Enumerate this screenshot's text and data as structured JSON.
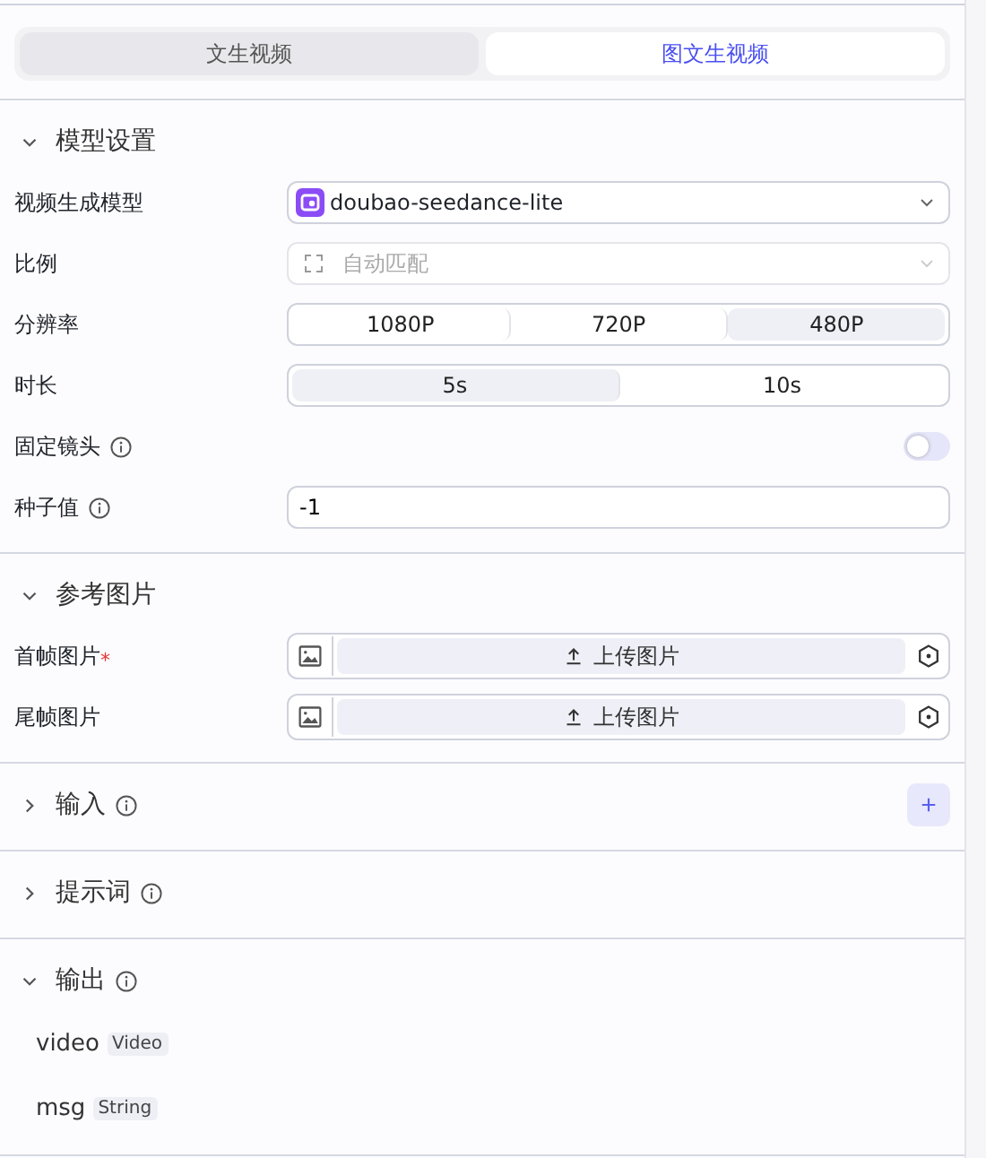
{
  "mode_tabs": [
    {
      "label": "文生视频",
      "selected": false
    },
    {
      "label": "图文生视频",
      "selected": true
    }
  ],
  "sections": [
    {
      "title": "模型设置",
      "expanded": true,
      "info": false,
      "fields": [
        {
          "kind": "model_select",
          "label": "视频生成模型",
          "value": "doubao-seedance-lite",
          "disabled": false
        },
        {
          "kind": "ratio_select",
          "label": "比例",
          "value": "自动匹配",
          "disabled": true
        },
        {
          "kind": "segmented",
          "label": "分辨率",
          "options": [
            {
              "label": "1080P",
              "selected": false
            },
            {
              "label": "720P",
              "selected": false
            },
            {
              "label": "480P",
              "selected": true
            }
          ]
        },
        {
          "kind": "segmented",
          "label": "时长",
          "options": [
            {
              "label": "5s",
              "selected": true
            },
            {
              "label": "10s",
              "selected": false
            }
          ]
        },
        {
          "kind": "switch",
          "label": "固定镜头",
          "info": true,
          "on": false
        },
        {
          "kind": "input",
          "label": "种子值",
          "info": true,
          "value": "-1"
        }
      ]
    },
    {
      "title": "参考图片",
      "expanded": true,
      "info": false,
      "fields": [
        {
          "kind": "upload",
          "label": "首帧图片",
          "required_mark": "*",
          "button": "上传图片"
        },
        {
          "kind": "upload",
          "label": "尾帧图片",
          "button": "上传图片"
        }
      ]
    },
    {
      "title": "输入",
      "expanded": false,
      "info": true,
      "action": "+"
    },
    {
      "title": "提示词",
      "expanded": false,
      "info": true
    },
    {
      "title": "输出",
      "expanded": true,
      "info": true,
      "outputs": [
        {
          "name": "video",
          "type": "Video"
        },
        {
          "name": "msg",
          "type": "String"
        }
      ]
    }
  ]
}
